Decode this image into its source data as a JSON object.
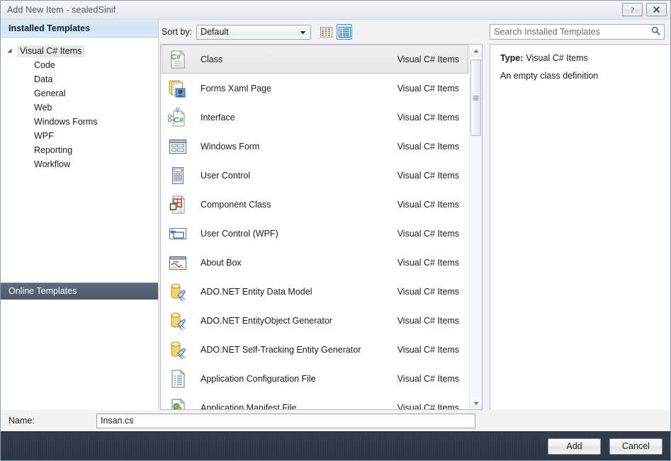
{
  "window": {
    "title": "Add New Item - sealedSinif",
    "help_button": "?",
    "close_button": "✕"
  },
  "sidebar": {
    "header": "Installed Templates",
    "root": {
      "label": "Visual C# Items",
      "expanded": true
    },
    "items": [
      {
        "label": "Code"
      },
      {
        "label": "Data"
      },
      {
        "label": "General"
      },
      {
        "label": "Web"
      },
      {
        "label": "Windows Forms"
      },
      {
        "label": "WPF"
      },
      {
        "label": "Reporting"
      },
      {
        "label": "Workflow"
      }
    ],
    "online_templates": "Online Templates"
  },
  "toolbar": {
    "sort_label": "Sort by:",
    "sort_value": "Default",
    "view_small_icons": "small-icons-view",
    "view_list": "list-view",
    "view_selected": "list-view"
  },
  "search": {
    "placeholder": "Search Installed Templates"
  },
  "list": {
    "selected_index": 0,
    "items": [
      {
        "name": "Class",
        "category": "Visual C# Items",
        "icon": "csharp-class-file-icon"
      },
      {
        "name": "Forms Xaml Page",
        "category": "Visual C# Items",
        "icon": "forms-xaml-page-icon"
      },
      {
        "name": "Interface",
        "category": "Visual C# Items",
        "icon": "csharp-interface-icon"
      },
      {
        "name": "Windows Form",
        "category": "Visual C# Items",
        "icon": "windows-form-icon"
      },
      {
        "name": "User Control",
        "category": "Visual C# Items",
        "icon": "user-control-icon"
      },
      {
        "name": "Component Class",
        "category": "Visual C# Items",
        "icon": "component-class-icon"
      },
      {
        "name": "User Control (WPF)",
        "category": "Visual C# Items",
        "icon": "user-control-wpf-icon"
      },
      {
        "name": "About Box",
        "category": "Visual C# Items",
        "icon": "about-box-icon"
      },
      {
        "name": "ADO.NET Entity Data Model",
        "category": "Visual C# Items",
        "icon": "ado-net-entity-icon"
      },
      {
        "name": "ADO.NET EntityObject Generator",
        "category": "Visual C# Items",
        "icon": "ado-net-entity-icon"
      },
      {
        "name": "ADO.NET Self-Tracking Entity Generator",
        "category": "Visual C# Items",
        "icon": "ado-net-entity-icon"
      },
      {
        "name": "Application Configuration File",
        "category": "Visual C# Items",
        "icon": "config-file-icon"
      },
      {
        "name": "Application Manifest File",
        "category": "Visual C# Items",
        "icon": "manifest-file-icon"
      }
    ]
  },
  "detail": {
    "type_label": "Type:",
    "type_value": "Visual C# Items",
    "description": "An empty class definition"
  },
  "name_field": {
    "label": "Name:",
    "value": "Insan.cs"
  },
  "footer": {
    "add": "Add",
    "cancel": "Cancel"
  },
  "colors": {
    "accent_blue": "#cfe3f6",
    "online_bar": "#566274",
    "footer": "#2b3442",
    "selected_row": "#e7e7e7",
    "csharp_green": "#3faa3f"
  }
}
